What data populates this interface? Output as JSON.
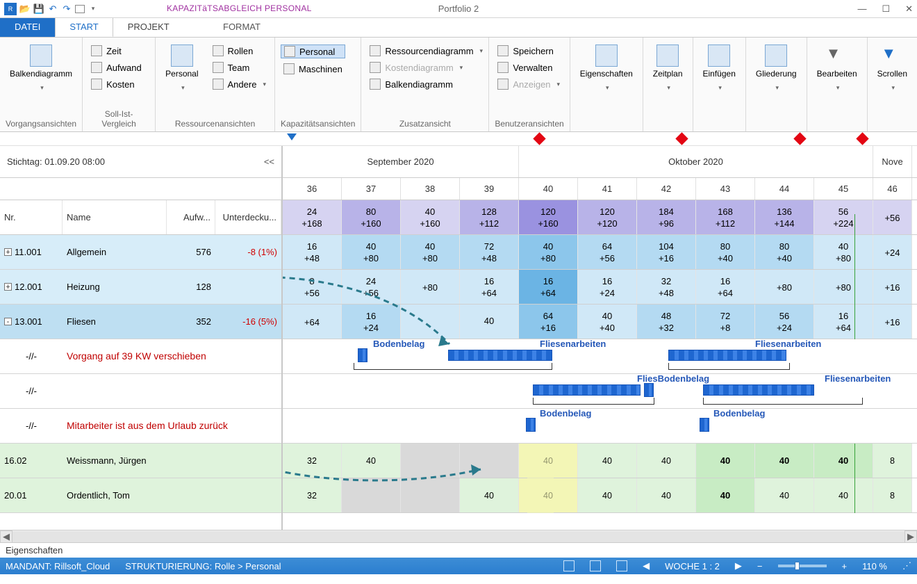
{
  "window": {
    "contextualTabGroup": "KAPAZITäTSABGLEICH PERSONAL",
    "title": "Portfolio 2"
  },
  "tabs": {
    "datei": "DATEI",
    "start": "START",
    "projekt": "PROJEKT",
    "format": "FORMAT"
  },
  "ribbon": {
    "vorgang": {
      "balken": "Balkendiagramm",
      "label": "Vorgangsansichten"
    },
    "soll": {
      "zeit": "Zeit",
      "aufwand": "Aufwand",
      "kosten": "Kosten",
      "label": "Soll-Ist-Vergleich"
    },
    "ressource": {
      "personal": "Personal",
      "rollen": "Rollen",
      "team": "Team",
      "andere": "Andere",
      "label": "Ressourcenansichten"
    },
    "kap": {
      "personal": "Personal",
      "maschinen": "Maschinen",
      "label": "Kapazitätsansichten"
    },
    "zusatz": {
      "res": "Ressourcendiagramm",
      "kost": "Kostendiagramm",
      "balk": "Balkendiagramm",
      "label": "Zusatzansicht"
    },
    "benutzer": {
      "speichern": "Speichern",
      "verwalten": "Verwalten",
      "anzeigen": "Anzeigen",
      "label": "Benutzeransichten"
    },
    "eigenschaften": "Eigenschaften",
    "zeitplan": "Zeitplan",
    "einf": "Einfügen",
    "glied": "Gliederung",
    "bearb": "Bearbeiten",
    "scroll": "Scrollen"
  },
  "leftHeader": {
    "stichtag": "Stichtag: 01.09.20 08:00",
    "collapse": "<<",
    "cols": {
      "nr": "Nr.",
      "name": "Name",
      "aufw": "Aufw...",
      "unt": "Unterdecku..."
    }
  },
  "rows": [
    {
      "type": "group-a",
      "expander": "+",
      "nr": "11.001",
      "name": "Allgemein",
      "aufw": "576",
      "unt": "-8 (1%)"
    },
    {
      "type": "group-a",
      "expander": "+",
      "nr": "12.001",
      "name": "Heizung",
      "aufw": "128",
      "unt": ""
    },
    {
      "type": "group-b",
      "expander": "-",
      "nr": "13.001",
      "name": "Fliesen",
      "aufw": "352",
      "unt": "-16 (5%)"
    },
    {
      "type": "task-anno",
      "nr": "-//-",
      "anno": "Vorgang auf 39 KW verschieben"
    },
    {
      "type": "task-anno",
      "nr": "-//-",
      "anno": ""
    },
    {
      "type": "task-anno",
      "nr": "-//-",
      "anno": "Mitarbeiter ist aus dem Urlaub zurück"
    },
    {
      "type": "person",
      "nr": "16.02",
      "name": "Weissmann, Jürgen"
    },
    {
      "type": "person",
      "nr": "20.01",
      "name": "Ordentlich, Tom"
    }
  ],
  "timeline": {
    "months": [
      {
        "label": "September 2020",
        "weeks": 4
      },
      {
        "label": "Oktober 2020",
        "weeks": 6
      },
      {
        "label": "Nove",
        "weeks": 0.66
      }
    ],
    "weeks": [
      "36",
      "37",
      "38",
      "39",
      "40",
      "41",
      "42",
      "43",
      "44",
      "45",
      "46"
    ]
  },
  "capacity": {
    "summary": [
      {
        "top": "24",
        "bot": "+168",
        "cls": "purple"
      },
      {
        "top": "80",
        "bot": "+160",
        "cls": "purple-dk"
      },
      {
        "top": "40",
        "bot": "+160",
        "cls": "purple"
      },
      {
        "top": "128",
        "bot": "+112",
        "cls": "purple-dk"
      },
      {
        "top": "120",
        "bot": "+160",
        "cls": "purple-dk2"
      },
      {
        "top": "120",
        "bot": "+120",
        "cls": "purple-dk"
      },
      {
        "top": "184",
        "bot": "+96",
        "cls": "purple-dk"
      },
      {
        "top": "168",
        "bot": "+112",
        "cls": "purple-dk"
      },
      {
        "top": "136",
        "bot": "+144",
        "cls": "purple-dk"
      },
      {
        "top": "56",
        "bot": "+224",
        "cls": "purple"
      },
      {
        "top": "",
        "bot": "+56",
        "cls": "purple"
      }
    ],
    "allgemein": [
      {
        "top": "16",
        "bot": "+48",
        "cls": "blue-l"
      },
      {
        "top": "40",
        "bot": "+80",
        "cls": "blue-m"
      },
      {
        "top": "40",
        "bot": "+80",
        "cls": "blue-m"
      },
      {
        "top": "72",
        "bot": "+48",
        "cls": "blue-m"
      },
      {
        "top": "40",
        "bot": "+80",
        "cls": "blue-d"
      },
      {
        "top": "64",
        "bot": "+56",
        "cls": "blue-m"
      },
      {
        "top": "104",
        "bot": "+16",
        "cls": "blue-m"
      },
      {
        "top": "80",
        "bot": "+40",
        "cls": "blue-m"
      },
      {
        "top": "80",
        "bot": "+40",
        "cls": "blue-m"
      },
      {
        "top": "40",
        "bot": "+80",
        "cls": "blue-l"
      },
      {
        "top": "",
        "bot": "+24",
        "cls": "blue-l"
      }
    ],
    "heizung": [
      {
        "top": "8",
        "bot": "+56",
        "cls": "blue-l"
      },
      {
        "top": "24",
        "bot": "+56",
        "cls": "blue-l"
      },
      {
        "top": "",
        "bot": "+80",
        "cls": "blue-l"
      },
      {
        "top": "16",
        "bot": "+64",
        "cls": "blue-l"
      },
      {
        "top": "16",
        "bot": "+64",
        "cls": "blue-dd"
      },
      {
        "top": "16",
        "bot": "+24",
        "cls": "blue-l"
      },
      {
        "top": "32",
        "bot": "+48",
        "cls": "blue-l"
      },
      {
        "top": "16",
        "bot": "+64",
        "cls": "blue-l"
      },
      {
        "top": "",
        "bot": "+80",
        "cls": "blue-l"
      },
      {
        "top": "",
        "bot": "+80",
        "cls": "blue-l"
      },
      {
        "top": "",
        "bot": "+16",
        "cls": "blue-l"
      }
    ],
    "fliesen": [
      {
        "top": "",
        "bot": "+64",
        "cls": "blue-l"
      },
      {
        "top": "16",
        "bot": "+24",
        "cls": "blue-m"
      },
      {
        "top": "",
        "bot": "",
        "cls": "blue-l"
      },
      {
        "top": "40",
        "bot": "",
        "cls": "blue-l"
      },
      {
        "top": "64",
        "bot": "+16",
        "cls": "blue-d"
      },
      {
        "top": "40",
        "bot": "+40",
        "cls": "blue-l"
      },
      {
        "top": "48",
        "bot": "+32",
        "cls": "blue-m"
      },
      {
        "top": "72",
        "bot": "+8",
        "cls": "blue-m"
      },
      {
        "top": "56",
        "bot": "+24",
        "cls": "blue-m"
      },
      {
        "top": "16",
        "bot": "+64",
        "cls": "blue-l"
      },
      {
        "top": "",
        "bot": "+16",
        "cls": "blue-l"
      }
    ],
    "weissmann": [
      "32",
      "40",
      "",
      "",
      "40",
      "40",
      "40",
      "40",
      "40",
      "40",
      "8"
    ],
    "ordentlich": [
      "32",
      "",
      "",
      "40",
      "40",
      "40",
      "40",
      "40",
      "40",
      "40",
      "8"
    ]
  },
  "ganttLabels": {
    "bodenbelag": "Bodenbelag",
    "fliesenarbeiten": "Fliesenarbeiten",
    "fliesenbodenbelag": "FliesBodenbelag"
  },
  "props": {
    "label": "Eigenschaften"
  },
  "status": {
    "mandant": "MANDANT: Rillsoft_Cloud",
    "strukt": "STRUKTURIERUNG: Rolle  >  Personal",
    "woche": "WOCHE 1 : 2",
    "zoom": "110 %"
  }
}
